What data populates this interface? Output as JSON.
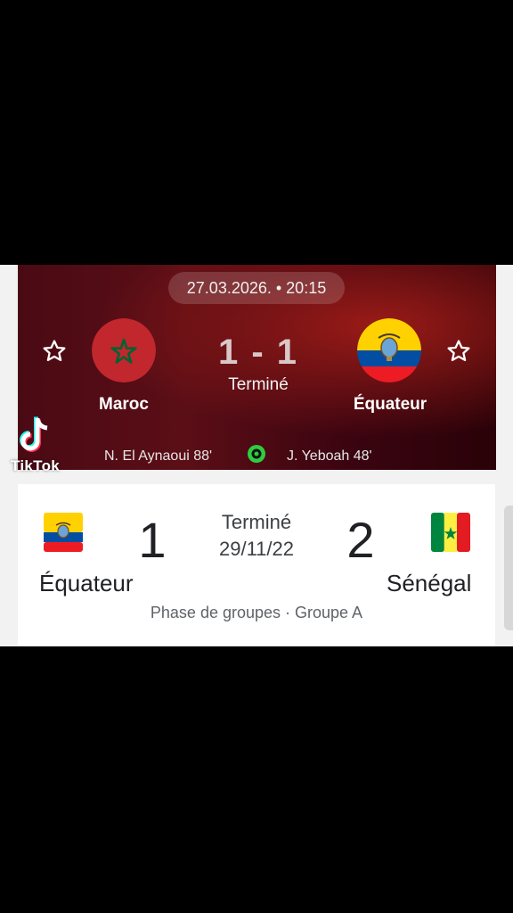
{
  "match1": {
    "datetime": "27.03.2026. • 20:15",
    "home": {
      "name": "Maroc",
      "flag": "morocco-flag-icon"
    },
    "away": {
      "name": "Équateur",
      "flag": "ecuador-flag-icon"
    },
    "score": "1 - 1",
    "status": "Terminé",
    "scorers": {
      "home": "N. El Aynaoui 88'",
      "away": "J. Yeboah 48'"
    }
  },
  "watermark": {
    "brand": "TikTok"
  },
  "match2": {
    "home": {
      "name": "Équateur",
      "score": "1",
      "flag": "ecuador-flag-icon"
    },
    "away": {
      "name": "Sénégal",
      "score": "2",
      "flag": "senegal-flag-icon"
    },
    "status": "Terminé",
    "date": "29/11/22",
    "phase": "Phase de groupes · Groupe A"
  },
  "colors": {
    "card_bg": "#4a0a14",
    "morocco_red": "#c1272d",
    "morocco_green": "#006233",
    "ecuador_yellow": "#ffd100",
    "ecuador_blue": "#034ea2",
    "ecuador_red": "#ed1c24",
    "senegal_green": "#00853f",
    "senegal_yellow": "#fdef42",
    "senegal_red": "#e31b23",
    "goal_icon": "#2ecc40"
  }
}
